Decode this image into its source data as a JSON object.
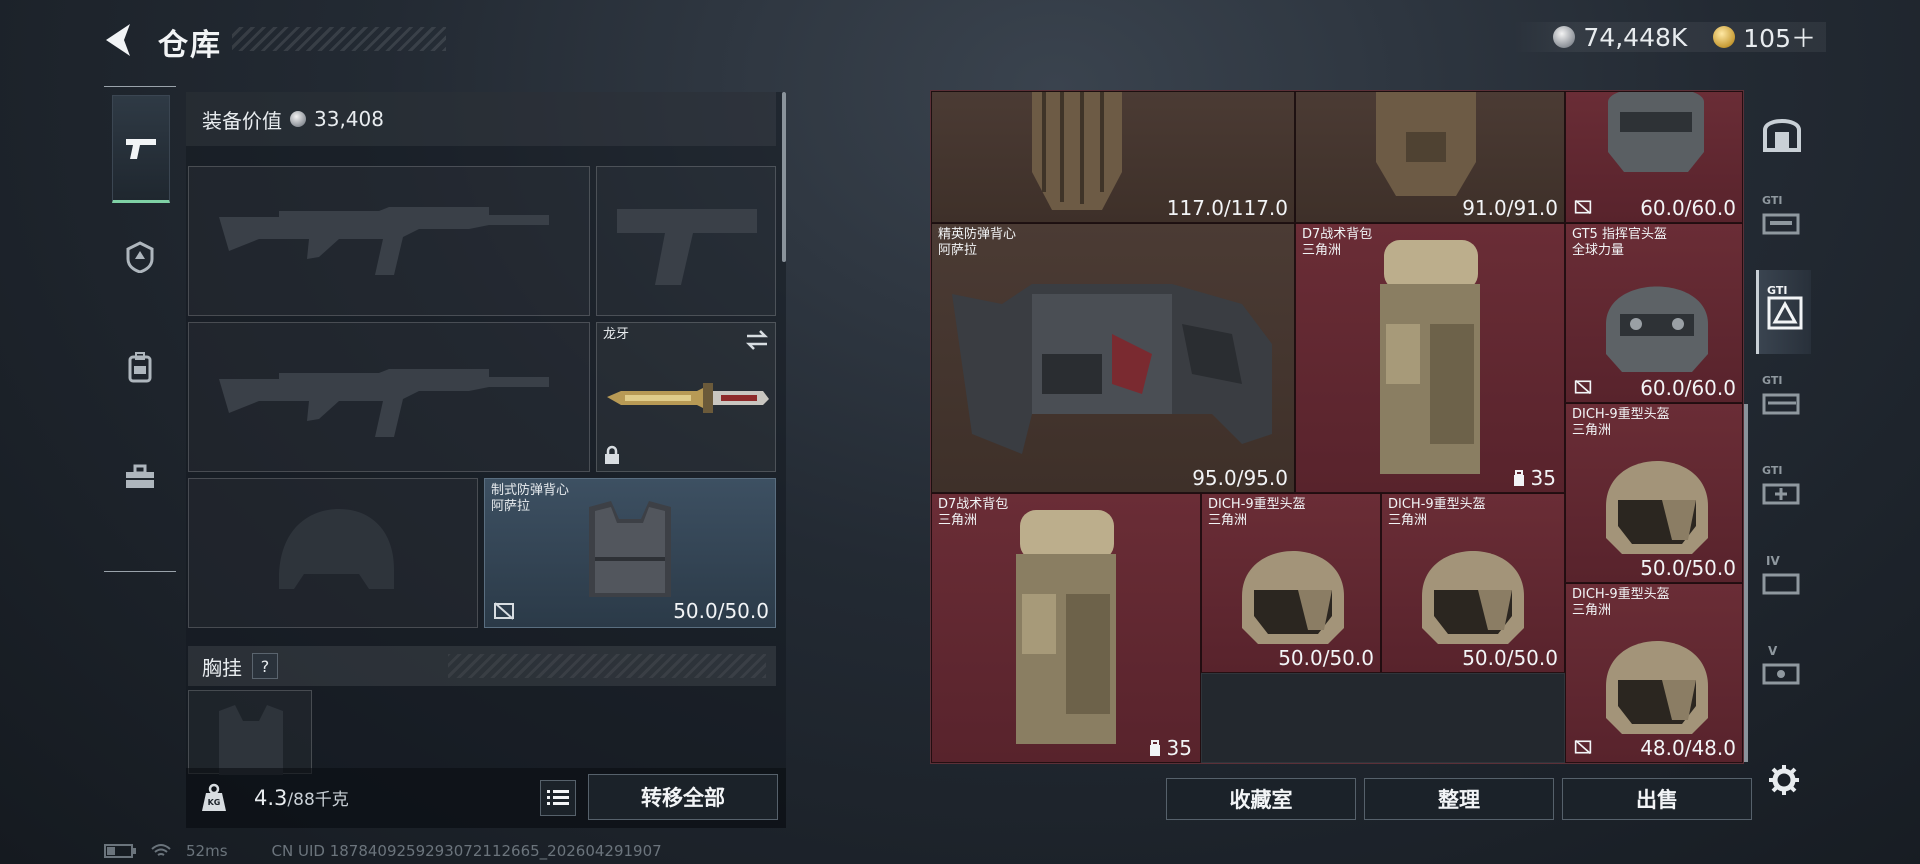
{
  "header": {
    "title": "仓库",
    "currency_silver": "74,448K",
    "currency_gold": "105＋",
    "colors": {
      "accent_green": "#7fd1a5",
      "stash_red": "#58232c"
    }
  },
  "left_nav": {
    "items": [
      {
        "name": "weapons",
        "icon": "pistol-icon",
        "active": true
      },
      {
        "name": "armor",
        "icon": "helmet-shield-icon",
        "active": false
      },
      {
        "name": "backpack",
        "icon": "backpack-icon",
        "active": false
      },
      {
        "name": "toolbox",
        "icon": "toolbox-icon",
        "active": false
      }
    ]
  },
  "loadout": {
    "equip_value_label": "装备价值",
    "equip_value": "33,408",
    "slots": {
      "primary_1": {
        "label": ""
      },
      "pistol": {
        "label": ""
      },
      "primary_2": {
        "label": ""
      },
      "melee": {
        "label": "龙牙",
        "icon": "swap-icon",
        "locked": true
      },
      "helmet": {
        "label": ""
      },
      "armor": {
        "label": "制式防弹背心\n阿萨拉",
        "durability": "50.0/50.0"
      }
    },
    "rig_label": "胸挂",
    "rig_help": "?",
    "weight": "4.3",
    "weight_cap": "/88千克",
    "weight_icon_text": "KG",
    "transfer_all": "转移全部"
  },
  "stash": {
    "items": [
      {
        "id": "top-1",
        "name": "",
        "durability": "117.0/117.0"
      },
      {
        "id": "top-2",
        "name": "",
        "durability": "91.0/91.0"
      },
      {
        "id": "top-3",
        "name": "",
        "durability": "60.0/60.0"
      },
      {
        "id": "elite-vest",
        "name": "精英防弹背心\n阿萨拉",
        "durability": "95.0/95.0"
      },
      {
        "id": "d7-bag-1",
        "name": "D7战术背包\n三角洲",
        "qty": "35"
      },
      {
        "id": "gt5-helmet",
        "name": "GT5 指挥官头盔\n全球力量",
        "durability": "60.0/60.0"
      },
      {
        "id": "dich-1",
        "name": "DICH-9重型头盔\n三角洲",
        "durability": "50.0/50.0"
      },
      {
        "id": "d7-bag-2",
        "name": "D7战术背包\n三角洲",
        "qty": "35"
      },
      {
        "id": "dich-2",
        "name": "DICH-9重型头盔\n三角洲",
        "durability": "50.0/50.0"
      },
      {
        "id": "dich-3",
        "name": "DICH-9重型头盔\n三角洲",
        "durability": "50.0/50.0"
      },
      {
        "id": "dich-4",
        "name": "DICH-9重型头盔\n三角洲",
        "durability": "48.0/48.0"
      }
    ],
    "collection_button": "收藏室",
    "sort_button": "整理",
    "sell_button": "出售"
  },
  "right_rail": {
    "tabs": [
      {
        "label": "",
        "icon": "vault-icon"
      },
      {
        "label": "GTI",
        "icon": "gti-weapon-icon"
      },
      {
        "label": "GTI",
        "icon": "gti-armor-icon",
        "active": true
      },
      {
        "label": "GTI",
        "icon": "gti-rifle-icon"
      },
      {
        "label": "GTI",
        "icon": "gti-medical-icon"
      },
      {
        "label": "IV",
        "icon": "storage-iv-icon"
      },
      {
        "label": "V",
        "icon": "storage-v-icon"
      }
    ],
    "settings_icon": "gear-icon"
  },
  "status": {
    "ping": "52ms",
    "uid": "CN UID 1878409259293072112665_202604291907"
  }
}
